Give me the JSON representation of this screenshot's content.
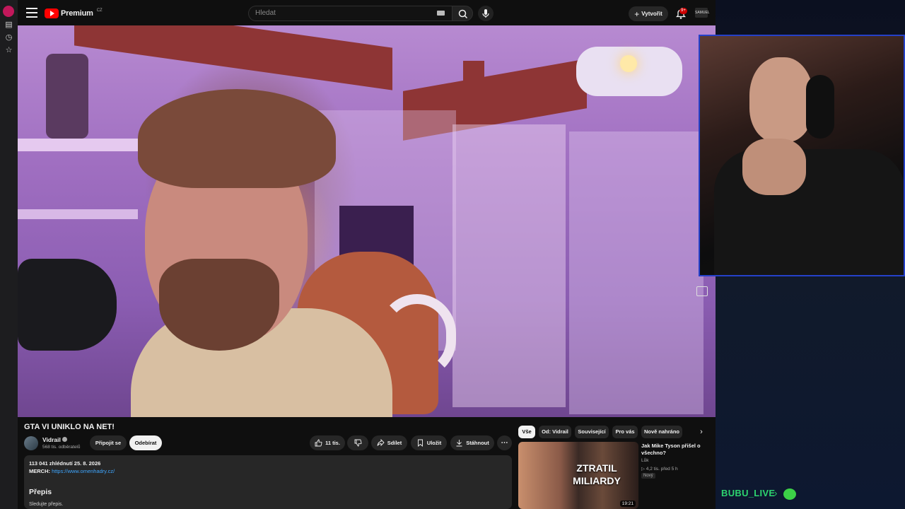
{
  "header": {
    "logo_text": "Premium",
    "logo_country": "CZ",
    "search_placeholder": "Hledat",
    "create_label": "Vytvořit",
    "notifications_badge": "9+",
    "account_label": "SAMUEL"
  },
  "video": {
    "title": "GTA VI UNIKLO NA NET!"
  },
  "channel": {
    "name": "Vidrail",
    "subscribers": "568 tis. odběratelů",
    "join_label": "Připojit se",
    "subscribe_label": "Odebírat"
  },
  "actions": {
    "likes": "11 tis.",
    "share_label": "Sdílet",
    "save_label": "Uložit",
    "download_label": "Stáhnout",
    "more_label": "⋯"
  },
  "description": {
    "stats": "113 041 zhlédnutí  25. 8. 2026",
    "merch_label": "MERCH:",
    "merch_link": "https://www.omenhadry.cz/",
    "transcript_heading": "Přepis",
    "transcript_sub": "Sledujte přepis."
  },
  "chips": [
    "Vše",
    "Od: Vidrail",
    "Související",
    "Pro vás",
    "Nově nahráno"
  ],
  "recommendation": {
    "title": "Jak Mike Tyson přišel o všechno?",
    "channel": "Lůk",
    "meta": "▷ 4,2 tis.   před 5 h",
    "badge": "Nový",
    "thumb_text": "ZTRATIL MILIARDY",
    "duration": "19:21"
  },
  "stream": {
    "label": "BUBU_LIVE",
    "chevron": "›"
  },
  "colors": {
    "accent_red": "#ff0000",
    "link_blue": "#3ea6ff",
    "stream_green": "#2dd36f",
    "webcam_border": "#2541c9"
  }
}
